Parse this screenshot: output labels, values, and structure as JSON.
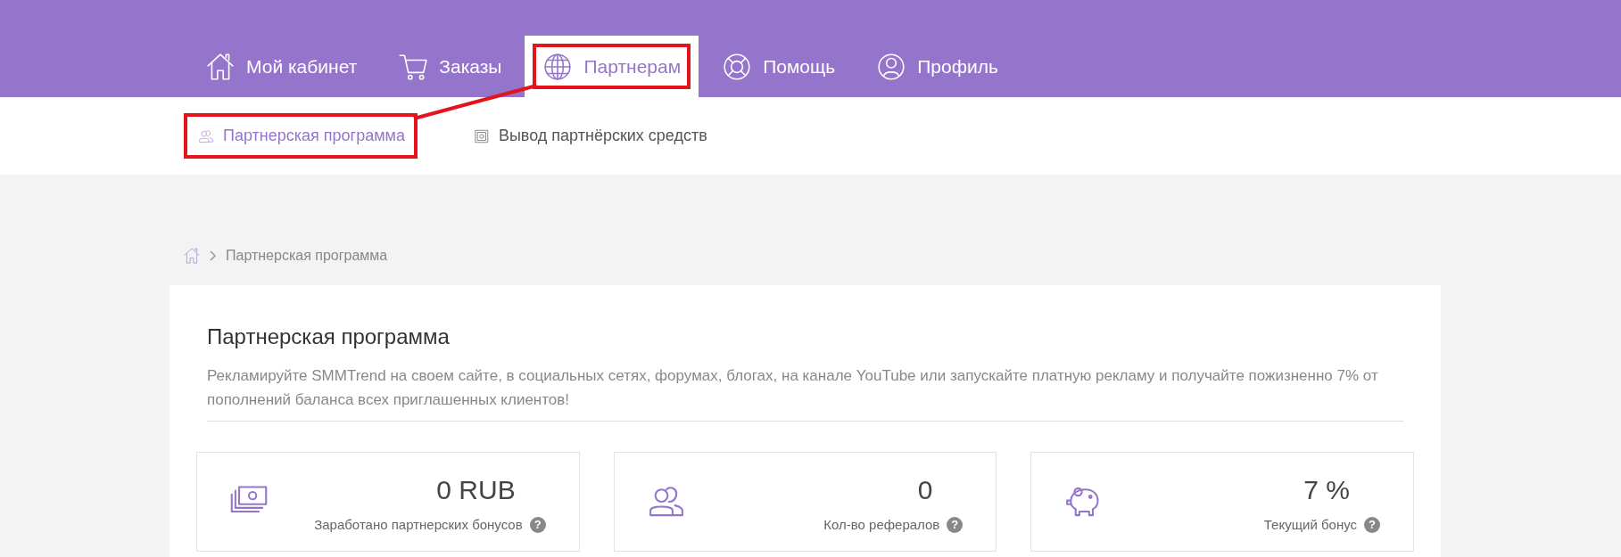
{
  "nav_tabs": [
    {
      "label": "Мой кабинет",
      "selected": false,
      "highlighted": false
    },
    {
      "label": "Заказы",
      "selected": false,
      "highlighted": false
    },
    {
      "label": "Партнерам",
      "selected": true,
      "highlighted": true
    },
    {
      "label": "Помощь",
      "selected": false,
      "highlighted": false
    },
    {
      "label": "Профиль",
      "selected": false,
      "highlighted": false
    }
  ],
  "sub_nav": [
    {
      "label": "Партнерская программа",
      "selected": true,
      "highlighted": true
    },
    {
      "label": "Вывод партнёрских средств",
      "selected": false,
      "highlighted": false
    }
  ],
  "annotation_connector": true,
  "breadcrumb": [
    "Партнерская программа"
  ],
  "panel": {
    "title": "Партнерская программа",
    "description": "Рекламируйте SMMTrend на своем сайте, в социальных сетях, форумах, блогах, на канале YouTube или запускайте платную рекламу и получайте пожизненно 7% от пополнений баланса всех приглашенных клиентов!"
  },
  "stats": [
    {
      "value": "0 RUB",
      "label": "Заработано партнерских бонусов",
      "help": "?"
    },
    {
      "value": "0",
      "label": "Кол-во рефералов",
      "help": "?"
    },
    {
      "value": "7 %",
      "label": "Текущий бонус",
      "help": "?"
    }
  ]
}
